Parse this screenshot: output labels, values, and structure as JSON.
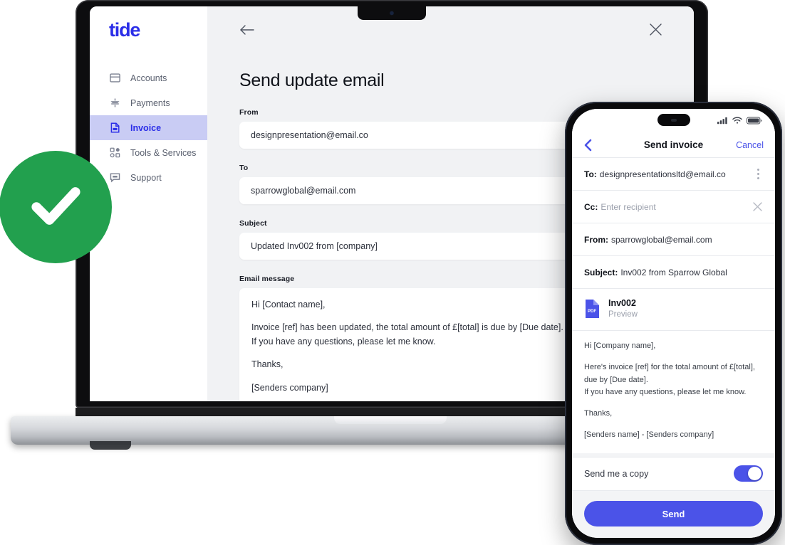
{
  "desktop": {
    "brand": "tide",
    "sidebar": {
      "items": [
        {
          "label": "Accounts",
          "icon": "accounts-icon",
          "active": false
        },
        {
          "label": "Payments",
          "icon": "payments-icon",
          "active": false
        },
        {
          "label": "Invoice",
          "icon": "invoice-icon",
          "active": true
        },
        {
          "label": "Tools & Services",
          "icon": "tools-icon",
          "active": false
        },
        {
          "label": "Support",
          "icon": "support-icon",
          "active": false
        }
      ]
    },
    "topbar": {
      "back_icon": "back-arrow-icon",
      "close_icon": "close-icon"
    },
    "page_title": "Send update email",
    "fields": {
      "from_label": "From",
      "from_value": "designpresentation@email.co",
      "to_label": "To",
      "to_value": "sparrowglobal@email.com",
      "to_menu_icon": "kebab-menu-icon",
      "subject_label": "Subject",
      "subject_value": "Updated Inv002 from [company]",
      "message_label": "Email message",
      "message_lines": [
        "Hi [Contact name],",
        "Invoice [ref] has  been updated, the total amount of £[total] is due by [Due date].\nIf you have any questions, please let me know.",
        "Thanks,",
        "[Senders company]"
      ],
      "message_p1": "Hi [Contact name],",
      "message_p2a": "Invoice [ref] has  been updated, the total amount of £[total] is due by [Due date].",
      "message_p2b": "If you have any questions, please let me know.",
      "message_p3": "Thanks,",
      "message_p4": "[Senders company]"
    }
  },
  "phone": {
    "status": {
      "cellular_icon": "cellular-signal-icon",
      "wifi_icon": "wifi-icon",
      "battery_icon": "battery-icon"
    },
    "nav": {
      "back_icon": "chevron-left-icon",
      "title": "Send invoice",
      "cancel": "Cancel"
    },
    "rows": {
      "to_label": "To:",
      "to_value": "designpresentationsltd@email.co",
      "to_menu_icon": "kebab-menu-icon",
      "cc_label": "Cc:",
      "cc_placeholder": "Enter recipient",
      "cc_clear_icon": "close-icon",
      "from_label": "From:",
      "from_value": "sparrowglobal@email.com",
      "subject_label": "Subject:",
      "subject_value": "Inv002 from Sparrow Global"
    },
    "attachment": {
      "badge": "PDF",
      "name": "Inv002",
      "action": "Preview"
    },
    "message": {
      "p1": "Hi [Company name],",
      "p2a": "Here's invoice [ref] for the total amount of £[total], due by [Due date].",
      "p2b": "If you have any questions, please let me know.",
      "p3": "Thanks,",
      "p4": "[Senders name] - [Senders company]"
    },
    "footer": {
      "copy_label": "Send me a copy",
      "copy_toggle_on": true,
      "send_label": "Send"
    }
  },
  "badge": {
    "icon": "check-circle-icon",
    "color": "#22a04e"
  },
  "colors": {
    "brand_blue": "#2b2ee8",
    "accent_indigo": "#4b53e8",
    "active_nav_bg": "#c9ccf4",
    "success_green": "#22a04e",
    "app_bg": "#f1f2f4"
  }
}
